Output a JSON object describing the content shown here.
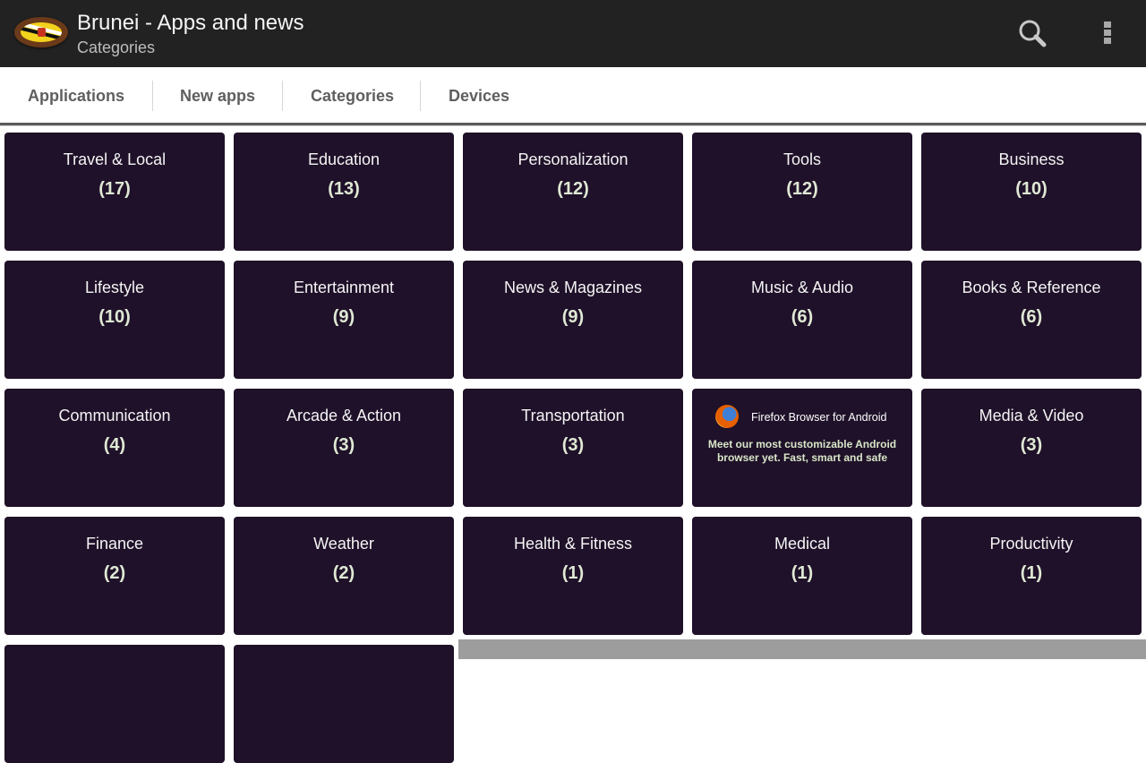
{
  "actionbar": {
    "title": "Brunei - Apps and news",
    "subtitle": "Categories",
    "logo_icon": "brunei-flag-icon",
    "search_icon": "search-icon",
    "overflow_icon": "overflow-menu-icon"
  },
  "tabs": [
    {
      "label": "Applications"
    },
    {
      "label": "New apps"
    },
    {
      "label": "Categories"
    },
    {
      "label": "Devices"
    }
  ],
  "categories": [
    {
      "name": "Travel & Local",
      "count": "(17)"
    },
    {
      "name": "Education",
      "count": "(13)"
    },
    {
      "name": "Personalization",
      "count": "(12)"
    },
    {
      "name": "Tools",
      "count": "(12)"
    },
    {
      "name": "Business",
      "count": "(10)"
    },
    {
      "name": "Lifestyle",
      "count": "(10)"
    },
    {
      "name": "Entertainment",
      "count": "(9)"
    },
    {
      "name": "News & Magazines",
      "count": "(9)"
    },
    {
      "name": "Music & Audio",
      "count": "(6)"
    },
    {
      "name": "Books & Reference",
      "count": "(6)"
    },
    {
      "name": "Communication",
      "count": "(4)"
    },
    {
      "name": "Arcade & Action",
      "count": "(3)"
    },
    {
      "name": "Transportation",
      "count": "(3)"
    },
    {
      "name": "Media & Video",
      "count": "(3)"
    },
    {
      "name": "Finance",
      "count": "(2)"
    },
    {
      "name": "Weather",
      "count": "(2)"
    },
    {
      "name": "Health & Fitness",
      "count": "(1)"
    },
    {
      "name": "Medical",
      "count": "(1)"
    },
    {
      "name": "Productivity",
      "count": "(1)"
    }
  ],
  "ad": {
    "icon": "firefox-icon",
    "title": "Firefox Browser for Android",
    "text": "Meet our most customizable Android browser yet. Fast, smart and safe"
  },
  "colors": {
    "actionbar": "#222222",
    "card": "#1f1129",
    "count_text": "#dfe8d4"
  }
}
